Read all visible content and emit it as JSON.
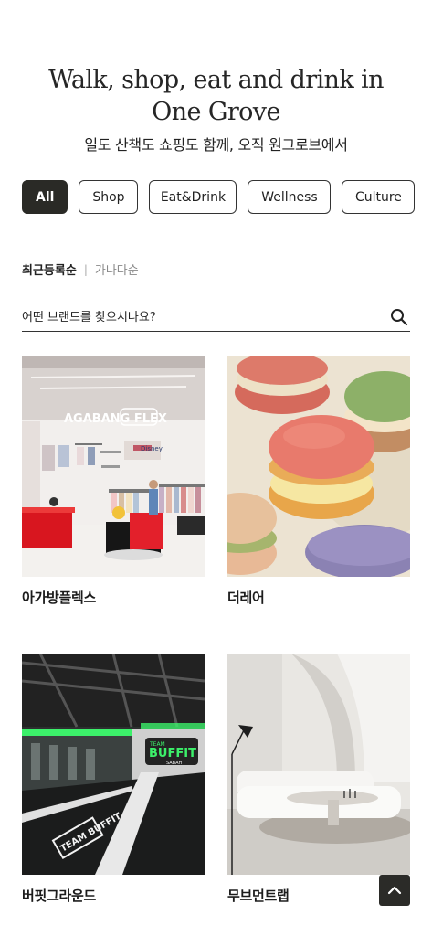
{
  "hero": {
    "title": "Walk, shop, eat and drink in One Grove",
    "subtitle": "일도 산책도 쇼핑도 함께, 오직 원그로브에서"
  },
  "filters": [
    {
      "label": "All",
      "active": true
    },
    {
      "label": "Shop",
      "active": false
    },
    {
      "label": "Eat&Drink",
      "active": false
    },
    {
      "label": "Wellness",
      "active": false
    },
    {
      "label": "Culture",
      "active": false
    }
  ],
  "sort": {
    "selected": "최근등록순",
    "other": "가나다순",
    "separator": "|"
  },
  "search": {
    "placeholder": "어떤 브랜드를 찾으시나요?",
    "icon": "search-icon"
  },
  "brands": [
    {
      "name": "아가방플렉스",
      "sign": "AGABANG FLEX",
      "sub_sign": "Disney"
    },
    {
      "name": "더레어"
    },
    {
      "name": "버핏그라운드",
      "sign": "BUFFIT",
      "sub_sign": "TEAM",
      "small_sign": "SABAH",
      "floor_text": "TEAM BUFFIT"
    },
    {
      "name": "무브먼트랩"
    }
  ],
  "scroll_top": {
    "icon": "chevron-up-icon"
  },
  "colors": {
    "active_chip": "#2a2a26",
    "text": "#1c1c1c",
    "neon_green": "#3cf06a"
  }
}
